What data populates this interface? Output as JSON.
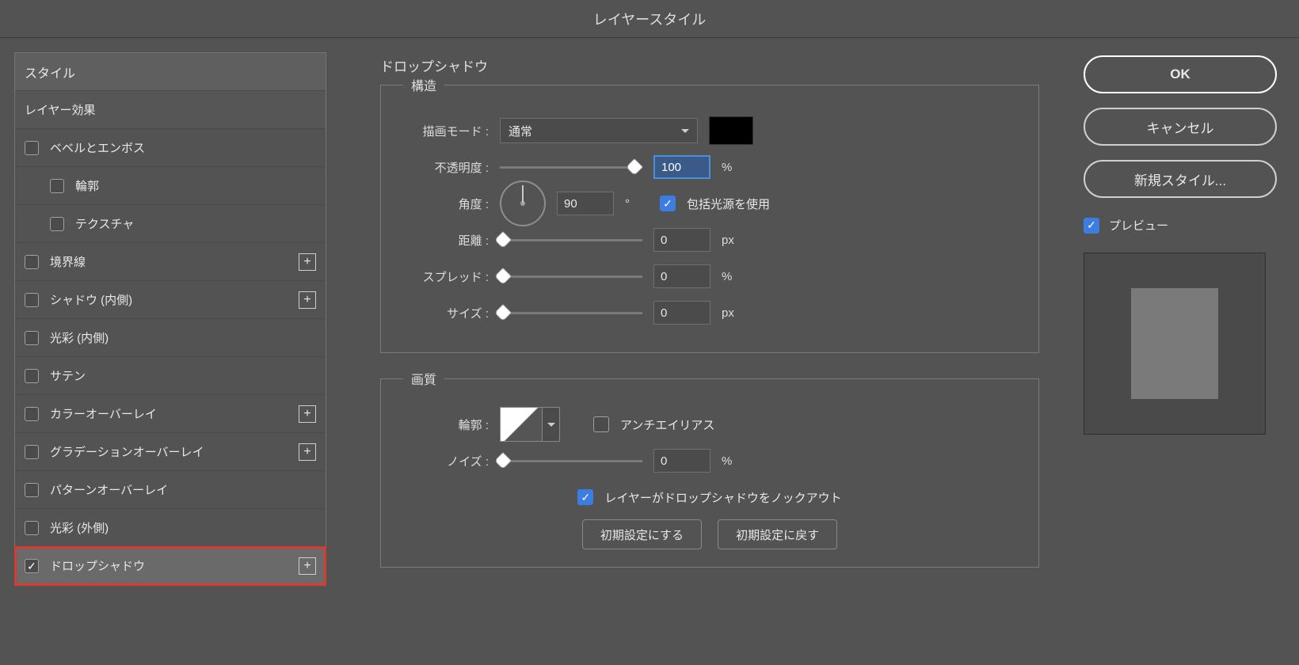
{
  "title": "レイヤースタイル",
  "left": {
    "header": "スタイル",
    "subheader": "レイヤー効果",
    "items": [
      {
        "label": "ベベルとエンボス",
        "checked": false,
        "add": false,
        "sub": false
      },
      {
        "label": "輪郭",
        "checked": false,
        "add": false,
        "sub": true
      },
      {
        "label": "テクスチャ",
        "checked": false,
        "add": false,
        "sub": true
      },
      {
        "label": "境界線",
        "checked": false,
        "add": true,
        "sub": false
      },
      {
        "label": "シャドウ (内側)",
        "checked": false,
        "add": true,
        "sub": false
      },
      {
        "label": "光彩 (内側)",
        "checked": false,
        "add": false,
        "sub": false
      },
      {
        "label": "サテン",
        "checked": false,
        "add": false,
        "sub": false
      },
      {
        "label": "カラーオーバーレイ",
        "checked": false,
        "add": true,
        "sub": false
      },
      {
        "label": "グラデーションオーバーレイ",
        "checked": false,
        "add": true,
        "sub": false
      },
      {
        "label": "パターンオーバーレイ",
        "checked": false,
        "add": false,
        "sub": false
      },
      {
        "label": "光彩 (外側)",
        "checked": false,
        "add": false,
        "sub": false
      },
      {
        "label": "ドロップシャドウ",
        "checked": true,
        "add": true,
        "sub": false,
        "selected": true
      }
    ]
  },
  "center": {
    "panel_title": "ドロップシャドウ",
    "structure": {
      "legend": "構造",
      "blend_label": "描画モード :",
      "blend_value": "通常",
      "opacity_label": "不透明度 :",
      "opacity_value": "100",
      "opacity_unit": "%",
      "angle_label": "角度 :",
      "angle_value": "90",
      "angle_unit": "°",
      "global_light_label": "包括光源を使用",
      "distance_label": "距離 :",
      "distance_value": "0",
      "distance_unit": "px",
      "spread_label": "スプレッド :",
      "spread_value": "0",
      "spread_unit": "%",
      "size_label": "サイズ :",
      "size_value": "0",
      "size_unit": "px"
    },
    "quality": {
      "legend": "画質",
      "contour_label": "輪郭 :",
      "antialias_label": "アンチエイリアス",
      "noise_label": "ノイズ :",
      "noise_value": "0",
      "noise_unit": "%"
    },
    "knockout_label": "レイヤーがドロップシャドウをノックアウト",
    "btn_set_default": "初期設定にする",
    "btn_reset_default": "初期設定に戻す"
  },
  "right": {
    "ok": "OK",
    "cancel": "キャンセル",
    "new_style": "新規スタイル...",
    "preview": "プレビュー"
  }
}
